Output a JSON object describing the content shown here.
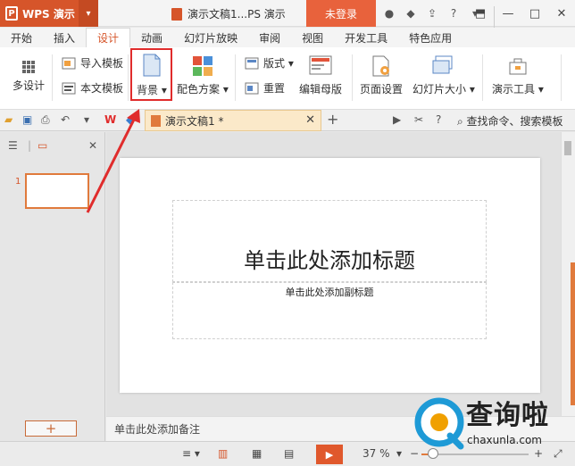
{
  "titlebar": {
    "app_name": "WPS 演示",
    "doc_title": "演示文稿1...PS 演示",
    "login_label": "未登录"
  },
  "tabs": [
    {
      "label": "开始"
    },
    {
      "label": "插入"
    },
    {
      "label": "设计",
      "active": true
    },
    {
      "label": "动画"
    },
    {
      "label": "幻灯片放映"
    },
    {
      "label": "审阅"
    },
    {
      "label": "视图"
    },
    {
      "label": "开发工具"
    },
    {
      "label": "特色应用"
    }
  ],
  "ribbon": {
    "multi_design": "多设计",
    "import_template": "导入模板",
    "text_template": "本文模板",
    "background": "背景",
    "color_scheme": "配色方案",
    "layout": "版式",
    "reset": "重置",
    "edit_master": "编辑母版",
    "page_setup": "页面设置",
    "slide_size": "幻灯片大小",
    "present_tools": "演示工具"
  },
  "qbar": {
    "doc_tab": "演示文稿1 *",
    "search": "查找命令、搜索模板"
  },
  "slide": {
    "number": "1",
    "title_placeholder": "单击此处添加标题",
    "subtitle_placeholder": "单击此处添加副标题"
  },
  "notes_placeholder": "单击此处添加备注",
  "status": {
    "zoom": "37 %"
  },
  "watermark": {
    "title": "查询啦",
    "domain": "chaxunla.com"
  },
  "colors": {
    "accent": "#d6552a",
    "highlight_border": "#e02c2c"
  }
}
